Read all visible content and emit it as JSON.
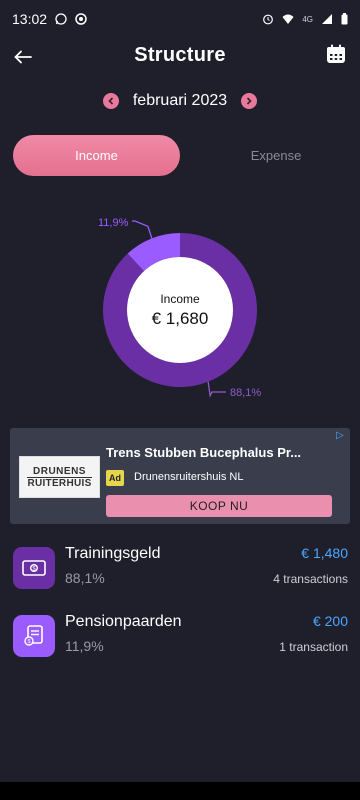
{
  "status": {
    "time": "13:02",
    "network": "4G",
    "left_icons": [
      "whatsapp-icon",
      "chrome-icon"
    ],
    "right_icons": [
      "alarm-icon",
      "wifi-icon",
      "signal-icon",
      "battery-icon"
    ]
  },
  "header": {
    "title": "Structure",
    "back_icon": "back-arrow-icon",
    "calendar_icon": "calendar-icon"
  },
  "period": {
    "label": "februari 2023",
    "prev_icon": "chevron-left-icon",
    "next_icon": "chevron-right-icon"
  },
  "tabs": {
    "income": "Income",
    "expense": "Expense",
    "selected": "income"
  },
  "chart_data": {
    "type": "pie",
    "categories": [
      "Trainingsgeld",
      "Pensionpaarden"
    ],
    "values": [
      1480,
      200
    ],
    "labels": [
      "88,1%",
      "11,9%"
    ],
    "colors": [
      "#6a2fa4",
      "#9b5cff"
    ],
    "center_label": "Income",
    "center_value": "€ 1,680"
  },
  "ad": {
    "title": "Trens Stubben Bucephalus Pr...",
    "badge": "Ad",
    "advertiser": "Drunensruitershuis NL",
    "cta": "KOOP NU",
    "logo_line1": "DRUNENS",
    "logo_line2": "RUITERHUIS"
  },
  "categories": [
    {
      "name": "Trainingsgeld",
      "percent": "88,1%",
      "amount": "€ 1,480",
      "transactions": "4 transactions",
      "icon": "banknote-icon",
      "color": "#6a2fa4"
    },
    {
      "name": "Pensionpaarden",
      "percent": "11,9%",
      "amount": "€ 200",
      "transactions": "1 transaction",
      "icon": "document-icon",
      "color": "#9b5cff"
    }
  ]
}
